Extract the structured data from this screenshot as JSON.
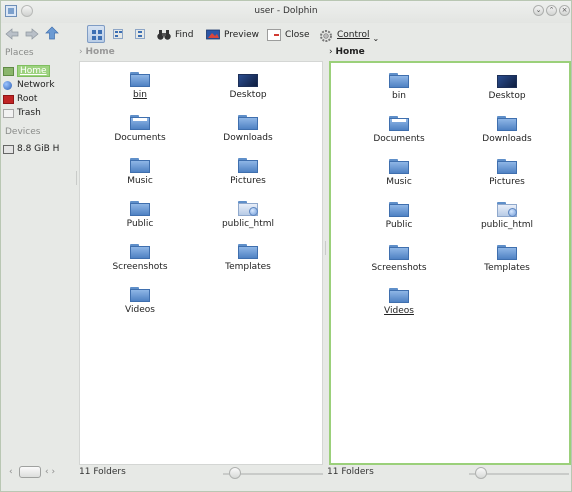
{
  "window": {
    "title": "user - Dolphin"
  },
  "toolbar": {
    "find_label": "Find",
    "preview_label": "Preview",
    "close_label": "Close",
    "control_label": "Control"
  },
  "places": {
    "header": "Places",
    "items": [
      {
        "label": "Home",
        "icon": "home-icon",
        "selected": true
      },
      {
        "label": "Network",
        "icon": "network-icon"
      },
      {
        "label": "Root",
        "icon": "root-folder-icon"
      },
      {
        "label": "Trash",
        "icon": "trash-icon"
      }
    ],
    "devices_header": "Devices",
    "devices": [
      {
        "label": "8.8 GiB H",
        "icon": "drive-icon"
      }
    ]
  },
  "left_pane": {
    "breadcrumb": "Home",
    "items": [
      {
        "label": "bin",
        "kind": "folder",
        "underlined": true
      },
      {
        "label": "Desktop",
        "kind": "desktop"
      },
      {
        "label": "Documents",
        "kind": "folder"
      },
      {
        "label": "Downloads",
        "kind": "folder"
      },
      {
        "label": "Music",
        "kind": "folder"
      },
      {
        "label": "Pictures",
        "kind": "folder"
      },
      {
        "label": "Public",
        "kind": "folder"
      },
      {
        "label": "public_html",
        "kind": "public_html"
      },
      {
        "label": "Screenshots",
        "kind": "folder"
      },
      {
        "label": "Templates",
        "kind": "folder"
      },
      {
        "label": "Videos",
        "kind": "folder"
      }
    ],
    "status": "11 Folders"
  },
  "right_pane": {
    "breadcrumb": "Home",
    "items": [
      {
        "label": "bin",
        "kind": "folder"
      },
      {
        "label": "Desktop",
        "kind": "desktop"
      },
      {
        "label": "Documents",
        "kind": "folder"
      },
      {
        "label": "Downloads",
        "kind": "folder"
      },
      {
        "label": "Music",
        "kind": "folder"
      },
      {
        "label": "Pictures",
        "kind": "folder"
      },
      {
        "label": "Public",
        "kind": "folder"
      },
      {
        "label": "public_html",
        "kind": "public_html"
      },
      {
        "label": "Screenshots",
        "kind": "folder"
      },
      {
        "label": "Templates",
        "kind": "folder"
      },
      {
        "label": "Videos",
        "kind": "folder",
        "underlined": true
      }
    ],
    "status": "11 Folders"
  },
  "colors": {
    "selection": "#9dd27f",
    "folder": "#4f82c3",
    "active_pane_border": "#9bd07a"
  }
}
